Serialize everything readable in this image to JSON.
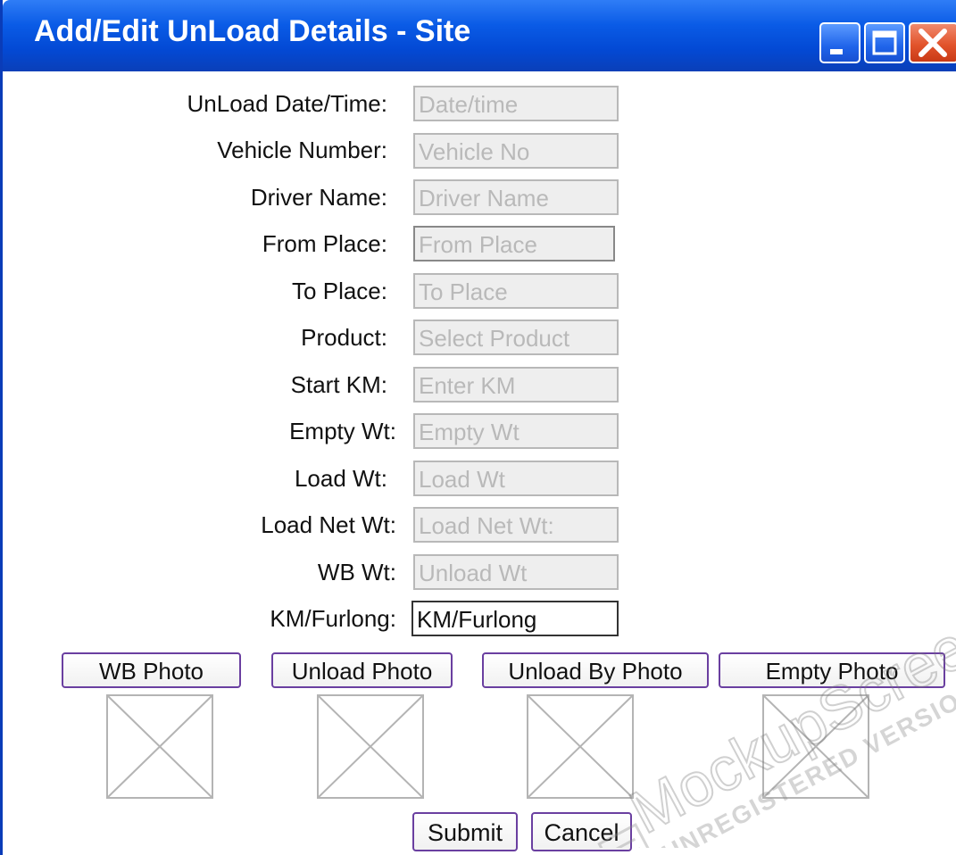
{
  "window": {
    "title": "Add/Edit UnLoad Details - Site",
    "controls": [
      "minimize-icon",
      "maximize-icon",
      "close-icon"
    ],
    "accent_color": "#0a5be6",
    "close_color": "#e2542c"
  },
  "form": {
    "fields": [
      {
        "label": "UnLoad Date/Time:",
        "placeholder": "Date/time",
        "value": ""
      },
      {
        "label": "Vehicle Number:",
        "placeholder": "Vehicle No",
        "value": ""
      },
      {
        "label": "Driver Name:",
        "placeholder": "Driver Name",
        "value": ""
      },
      {
        "label": "From Place:",
        "placeholder": "From Place",
        "value": ""
      },
      {
        "label": "To Place:",
        "placeholder": "To Place",
        "value": ""
      },
      {
        "label": "Product:",
        "placeholder": "Select Product",
        "value": ""
      },
      {
        "label": "Start KM:",
        "placeholder": "Enter KM",
        "value": ""
      },
      {
        "label": "Empty Wt:",
        "placeholder": "Empty Wt",
        "value": ""
      },
      {
        "label": "Load Wt:",
        "placeholder": "Load Wt",
        "value": ""
      },
      {
        "label": "Load Net Wt:",
        "placeholder": "Load Net Wt:",
        "value": ""
      },
      {
        "label": "WB Wt:",
        "placeholder": "Unload Wt",
        "value": ""
      },
      {
        "label": "KM/Furlong:",
        "placeholder": "",
        "value": "KM/Furlong"
      }
    ]
  },
  "photos": {
    "buttons": [
      "WB Photo",
      "Unload Photo",
      "Unload By Photo",
      "Empty Photo"
    ],
    "placeholder_icon": "image-placeholder-icon"
  },
  "actions": {
    "submit_label": "Submit",
    "cancel_label": "Cancel"
  },
  "watermark": {
    "brand": "MockupScreens",
    "subtitle": "UNREGISTERED VERSION"
  }
}
